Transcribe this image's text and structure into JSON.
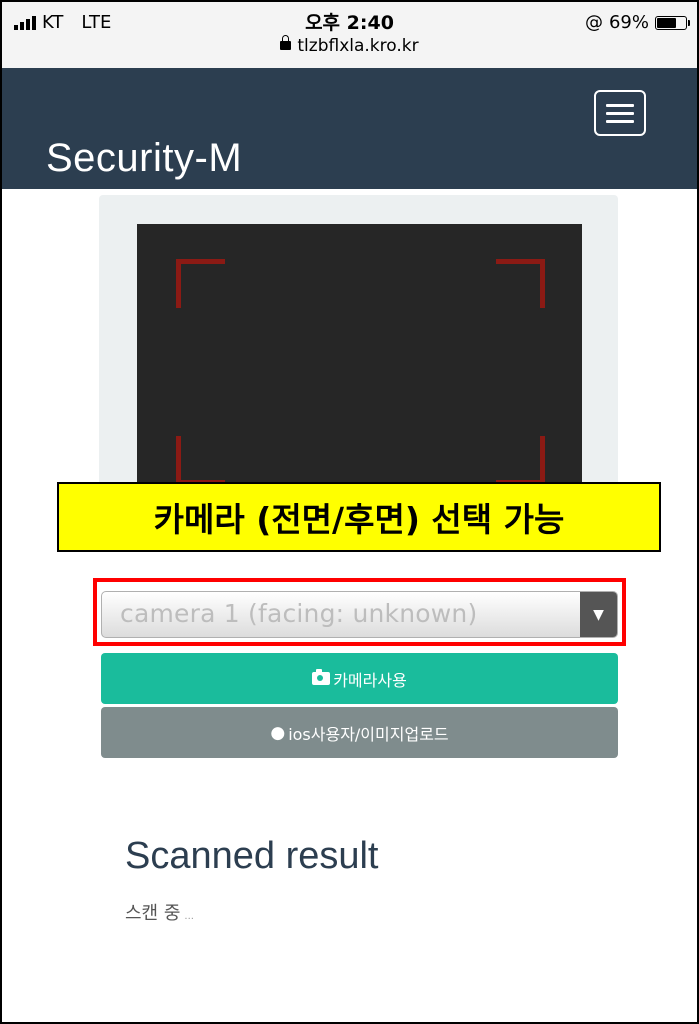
{
  "status_bar": {
    "carrier": "KT",
    "network": "LTE",
    "time": "오후 2:40",
    "url": "tlzbflxla.kro.kr",
    "alarm_icon": "@",
    "battery_percent": "69%",
    "battery_level": 0.69
  },
  "navbar": {
    "brand": "Security-M",
    "menu_icon": "hamburger-icon"
  },
  "annotation": {
    "text": "카메라 (전면/후면) 선택 가능",
    "background": "#ffff00"
  },
  "camera_select": {
    "selected": "camera 1 (facing: unknown)",
    "arrow": "▼"
  },
  "buttons": {
    "camera": {
      "icon": "camera-icon",
      "label": "카메라사용",
      "color": "#1abc9c"
    },
    "upload": {
      "icon": "apple-icon",
      "label": "ios사용자/이미지업로드",
      "color": "#7f8c8d"
    }
  },
  "result": {
    "title": "Scanned result",
    "status": "스캔 중",
    "dots": "..."
  },
  "colors": {
    "navbar": "#2c3e50",
    "scanner_corners": "#8b1a14",
    "highlight": "#ff0000"
  }
}
